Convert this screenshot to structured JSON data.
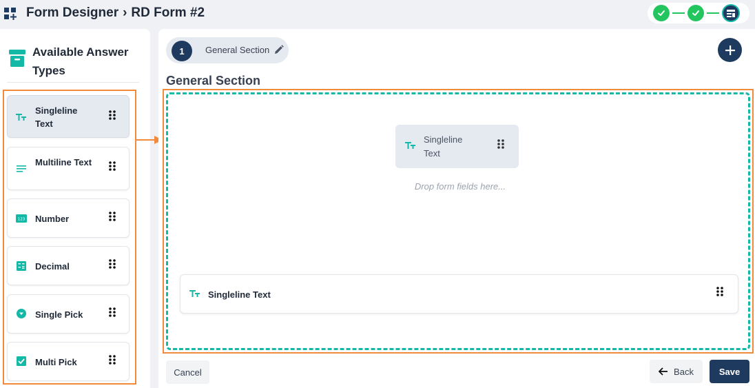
{
  "header": {
    "app": "Form Designer",
    "separator": "›",
    "form_name": "RD Form #2"
  },
  "stepper": {
    "steps": [
      {
        "status": "done",
        "icon": "check-icon"
      },
      {
        "status": "done",
        "icon": "check-icon"
      },
      {
        "status": "current",
        "icon": "form-design-icon"
      }
    ]
  },
  "sidebar": {
    "title": "Available Answer Types",
    "title_icon": "archive-box-icon",
    "items": [
      {
        "label": "Singleline Text",
        "icon": "text-type-icon",
        "active": true
      },
      {
        "label": "Multiline Text",
        "icon": "multiline-icon",
        "active": false
      },
      {
        "label": "Number",
        "icon": "number-icon",
        "active": false
      },
      {
        "label": "Decimal",
        "icon": "calculator-icon",
        "active": false
      },
      {
        "label": "Single Pick",
        "icon": "radio-dot-icon",
        "active": false
      },
      {
        "label": "Multi Pick",
        "icon": "checkbox-icon",
        "active": false
      }
    ]
  },
  "main": {
    "tab": {
      "number": "1",
      "label": "General Section"
    },
    "section_title": "General Section",
    "drag_preview": {
      "label": "Singleline Text"
    },
    "drop_placeholder": "Drop form fields here...",
    "fields": [
      {
        "label": "Singleline Text"
      }
    ]
  },
  "footer": {
    "cancel_label": "Cancel",
    "back_label": "Back",
    "save_label": "Save"
  },
  "colors": {
    "primary": "#1e3a5f",
    "accent": "#14b8a6",
    "success": "#22c55e",
    "highlight": "#f28a3b"
  }
}
